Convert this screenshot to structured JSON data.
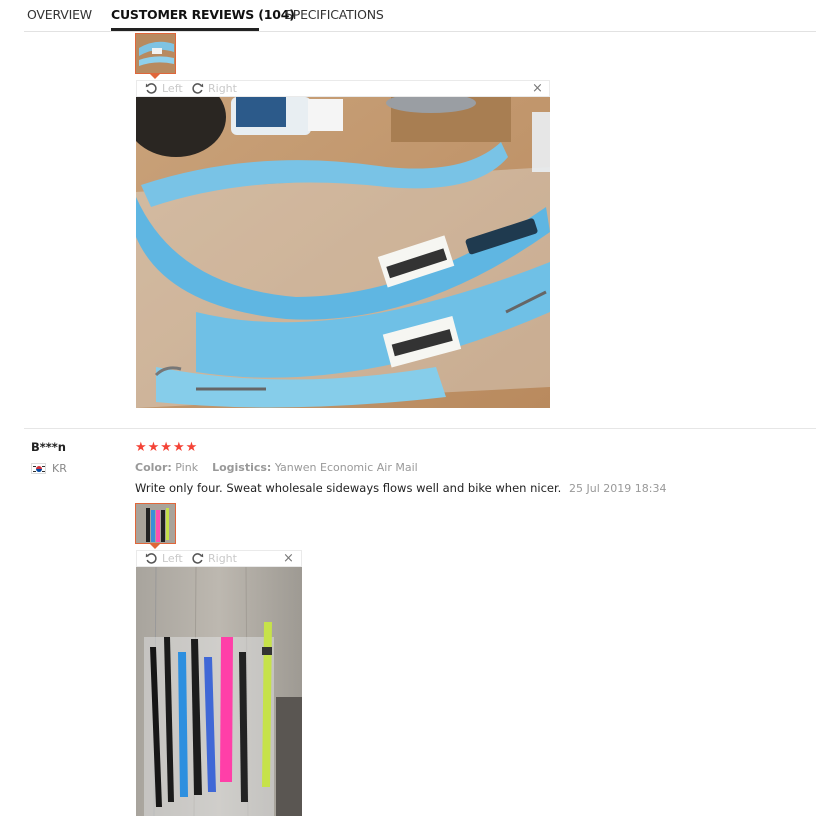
{
  "tabs": [
    {
      "label": "OVERVIEW",
      "active": false
    },
    {
      "label": "CUSTOMER REVIEWS (104)",
      "active": true
    },
    {
      "label": "SPECIFICATIONS",
      "active": false
    }
  ],
  "viewer": {
    "left_label": "Left",
    "right_label": "Right",
    "close_glyph": "×"
  },
  "reviews": [
    {
      "photo_description_hidden": true
    },
    {
      "user": "B***n",
      "country": "KR",
      "rating": 5,
      "stars": "★★★★★",
      "color_label": "Color:",
      "color_value": "Pink",
      "logistics_label": "Logistics:",
      "logistics_value": "Yanwen Economic Air Mail",
      "text": "Write only four. Sweat wholesale sideways flows well and bike when nicer.",
      "date": "25 Jul 2019 18:34"
    }
  ],
  "colors": {
    "accent": "#e0663a",
    "star": "#f44336",
    "active_tab_underline": "#222222"
  },
  "icons": [
    "rotate-left-icon",
    "rotate-right-icon",
    "close-icon",
    "korea-flag-icon",
    "star-icon"
  ]
}
